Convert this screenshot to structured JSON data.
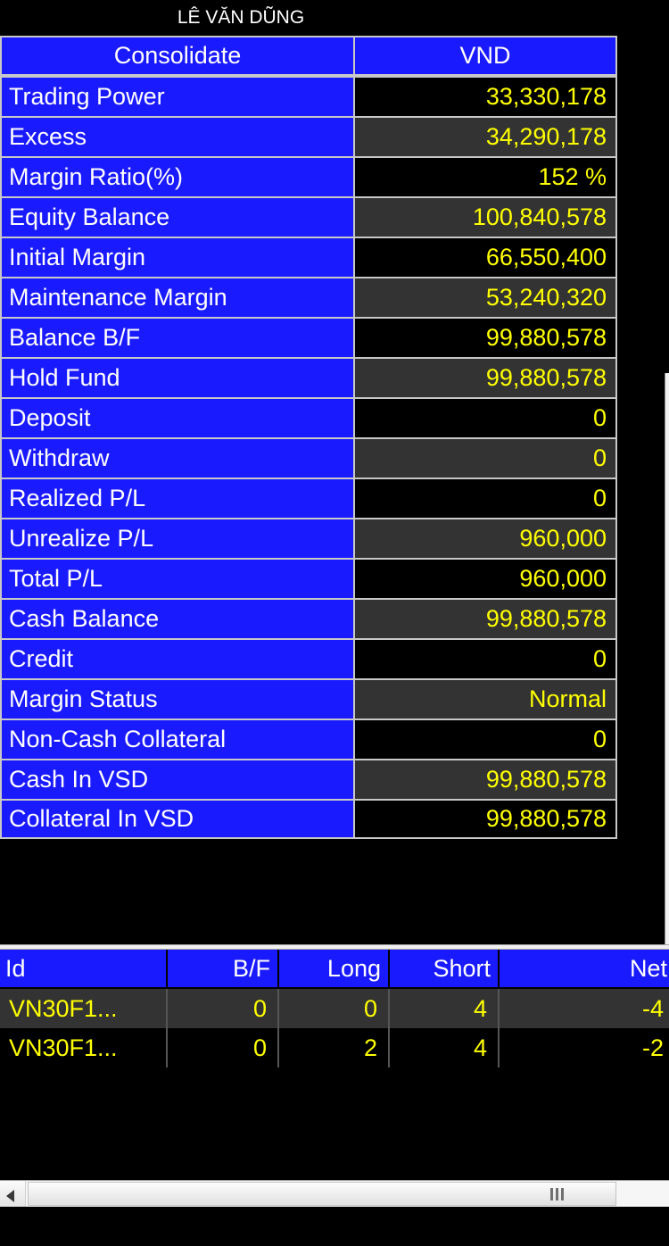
{
  "account": {
    "holder_name": "LÊ VĂN DŨNG"
  },
  "summary": {
    "header": {
      "label_column": "Consolidate",
      "value_column": "VND"
    },
    "rows": [
      {
        "label": "Trading Power",
        "value": "33,330,178"
      },
      {
        "label": "Excess",
        "value": "34,290,178"
      },
      {
        "label": "Margin Ratio(%)",
        "value": "152 %"
      },
      {
        "label": "Equity Balance",
        "value": "100,840,578"
      },
      {
        "label": "Initial Margin",
        "value": "66,550,400"
      },
      {
        "label": "Maintenance Margin",
        "value": "53,240,320"
      },
      {
        "label": "Balance B/F",
        "value": "99,880,578"
      },
      {
        "label": "Hold Fund",
        "value": "99,880,578"
      },
      {
        "label": "Deposit",
        "value": "0"
      },
      {
        "label": "Withdraw",
        "value": "0"
      },
      {
        "label": "Realized P/L",
        "value": "0"
      },
      {
        "label": "Unrealize P/L",
        "value": "960,000"
      },
      {
        "label": "Total P/L",
        "value": "960,000"
      },
      {
        "label": "Cash Balance",
        "value": "99,880,578"
      },
      {
        "label": "Credit",
        "value": "0"
      },
      {
        "label": "Margin Status",
        "value": "Normal"
      },
      {
        "label": "Non-Cash Collateral",
        "value": "0"
      },
      {
        "label": "Cash In VSD",
        "value": "99,880,578"
      },
      {
        "label": "Collateral In VSD",
        "value": "99,880,578"
      }
    ]
  },
  "positions": {
    "columns": [
      "Id",
      "B/F",
      "Long",
      "Short",
      "Net"
    ],
    "rows": [
      {
        "id": "VN30F1...",
        "bf": "0",
        "long": "0",
        "short": "4",
        "net": "-4"
      },
      {
        "id": "VN30F1...",
        "bf": "0",
        "long": "2",
        "short": "4",
        "net": "-2"
      }
    ]
  },
  "scrollbar": {
    "left_arrow_icon": "triangle-left-icon",
    "thumb_grip_icon": "grip-lines-icon"
  },
  "colors": {
    "header_blue": "#1a1aff",
    "value_yellow": "#ffff00",
    "label_text": "#ffffff",
    "row_alt_background": "#333333",
    "row_background": "#000000",
    "grid_line": "#c8c8c8"
  }
}
